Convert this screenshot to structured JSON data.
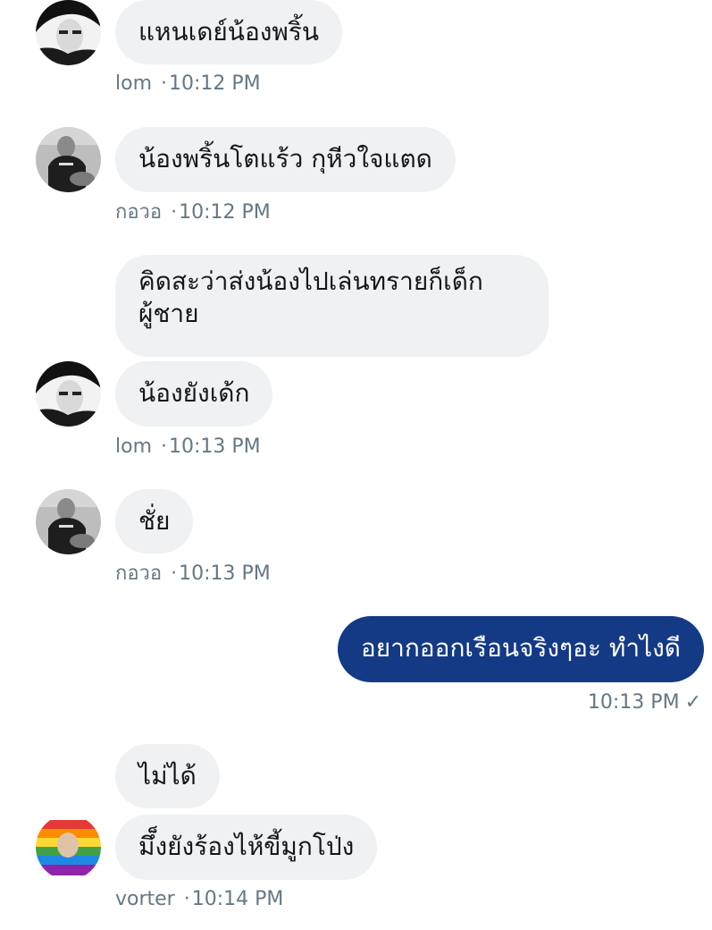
{
  "messages": [
    {
      "sender": "lom",
      "text": "แหนเดย์น้องพริ้น",
      "time": "10:12 PM"
    },
    {
      "sender": "กอวอ",
      "text": "น้องพริ้นโตแร้ว กุหีวใจแตด",
      "time": "10:12 PM"
    },
    {
      "sender": "lom",
      "text": "คิดสะว่าส่งน้องไปเล่นทรายก็เด็กผู้ชาย"
    },
    {
      "sender": "lom",
      "text": "น้องยังเด้ก",
      "time": "10:13 PM"
    },
    {
      "sender": "กอวอ",
      "text": "ชั่ย",
      "time": "10:13 PM"
    },
    {
      "sender": "me",
      "text": "อยากออกเรือนจริงๆอะ ทำไงดี",
      "time": "10:13 PM",
      "status": "✓"
    },
    {
      "sender": "vorter",
      "text": "ไม่ได้"
    },
    {
      "sender": "vorter",
      "text": "มึ็งยังร้องไห้ขี้มูกโป่ง",
      "time": "10:14 PM"
    }
  ],
  "meta_separator": "·",
  "colors": {
    "incoming_bubble": "#eff1f3",
    "outgoing_bubble": "#143a86",
    "meta_text": "#657786"
  },
  "icons": {
    "lom_avatar": "avatar-photo-bw-portrait",
    "kowo_avatar": "avatar-photo-grayscale-person",
    "vorter_avatar": "avatar-photo-rainbow"
  }
}
